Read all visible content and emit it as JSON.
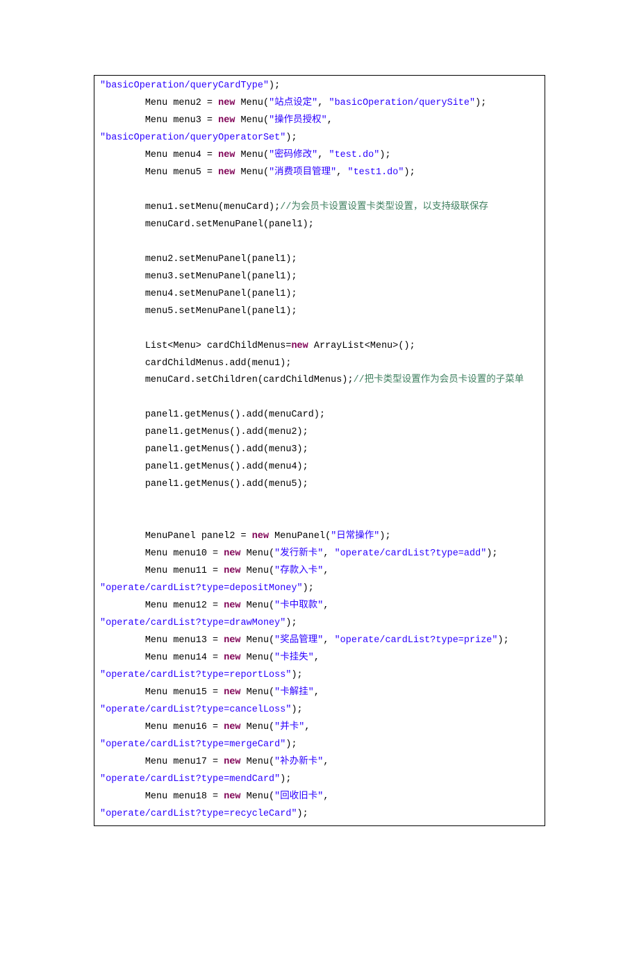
{
  "code_lines": [
    [
      {
        "c": "s",
        "t": "\"basicOperation/queryCardType\""
      },
      {
        "c": "p",
        "t": ");"
      }
    ],
    [
      {
        "c": "p",
        "t": "        Menu menu2 = "
      },
      {
        "c": "k",
        "t": "new"
      },
      {
        "c": "p",
        "t": " Menu("
      },
      {
        "c": "s",
        "t": "\"站点设定\""
      },
      {
        "c": "p",
        "t": ", "
      },
      {
        "c": "s",
        "t": "\"basicOperation/querySite\""
      },
      {
        "c": "p",
        "t": ");"
      }
    ],
    [
      {
        "c": "p",
        "t": "        Menu menu3 = "
      },
      {
        "c": "k",
        "t": "new"
      },
      {
        "c": "p",
        "t": " Menu("
      },
      {
        "c": "s",
        "t": "\"操作员授权\""
      },
      {
        "c": "p",
        "t": ", "
      }
    ],
    [
      {
        "c": "s",
        "t": "\"basicOperation/queryOperatorSet\""
      },
      {
        "c": "p",
        "t": ");"
      }
    ],
    [
      {
        "c": "p",
        "t": "        Menu menu4 = "
      },
      {
        "c": "k",
        "t": "new"
      },
      {
        "c": "p",
        "t": " Menu("
      },
      {
        "c": "s",
        "t": "\"密码修改\""
      },
      {
        "c": "p",
        "t": ", "
      },
      {
        "c": "s",
        "t": "\"test.do\""
      },
      {
        "c": "p",
        "t": ");"
      }
    ],
    [
      {
        "c": "p",
        "t": "        Menu menu5 = "
      },
      {
        "c": "k",
        "t": "new"
      },
      {
        "c": "p",
        "t": " Menu("
      },
      {
        "c": "s",
        "t": "\"消费项目管理\""
      },
      {
        "c": "p",
        "t": ", "
      },
      {
        "c": "s",
        "t": "\"test1.do\""
      },
      {
        "c": "p",
        "t": ");"
      }
    ],
    [
      {
        "c": "p",
        "t": "        "
      }
    ],
    [
      {
        "c": "p",
        "t": "        menu1.setMenu(menuCard);"
      },
      {
        "c": "c",
        "t": "//为会员卡设置设置卡类型设置，以支持级联保存"
      }
    ],
    [
      {
        "c": "p",
        "t": "        menuCard.setMenuPanel(panel1);"
      }
    ],
    [
      {
        "c": "p",
        "t": "        "
      }
    ],
    [
      {
        "c": "p",
        "t": "        menu2.setMenuPanel(panel1);"
      }
    ],
    [
      {
        "c": "p",
        "t": "        menu3.setMenuPanel(panel1);"
      }
    ],
    [
      {
        "c": "p",
        "t": "        menu4.setMenuPanel(panel1);"
      }
    ],
    [
      {
        "c": "p",
        "t": "        menu5.setMenuPanel(panel1);"
      }
    ],
    [
      {
        "c": "p",
        "t": "        "
      }
    ],
    [
      {
        "c": "p",
        "t": "        List<Menu> cardChildMenus="
      },
      {
        "c": "k",
        "t": "new"
      },
      {
        "c": "p",
        "t": " ArrayList<Menu>();"
      }
    ],
    [
      {
        "c": "p",
        "t": "        cardChildMenus.add(menu1);"
      }
    ],
    [
      {
        "c": "p",
        "t": "        menuCard.setChildren(cardChildMenus);"
      },
      {
        "c": "c",
        "t": "//把卡类型设置作为会员卡设置的子菜单"
      }
    ],
    [
      {
        "c": "p",
        "t": "        "
      }
    ],
    [
      {
        "c": "p",
        "t": "        panel1.getMenus().add(menuCard);"
      }
    ],
    [
      {
        "c": "p",
        "t": "        panel1.getMenus().add(menu2);"
      }
    ],
    [
      {
        "c": "p",
        "t": "        panel1.getMenus().add(menu3);"
      }
    ],
    [
      {
        "c": "p",
        "t": "        panel1.getMenus().add(menu4);"
      }
    ],
    [
      {
        "c": "p",
        "t": "        panel1.getMenus().add(menu5);"
      }
    ],
    [
      {
        "c": "p",
        "t": "        "
      }
    ],
    [
      {
        "c": "p",
        "t": "        "
      }
    ],
    [
      {
        "c": "p",
        "t": "        MenuPanel panel2 = "
      },
      {
        "c": "k",
        "t": "new"
      },
      {
        "c": "p",
        "t": " MenuPanel("
      },
      {
        "c": "s",
        "t": "\"日常操作\""
      },
      {
        "c": "p",
        "t": ");"
      }
    ],
    [
      {
        "c": "p",
        "t": "        Menu menu10 = "
      },
      {
        "c": "k",
        "t": "new"
      },
      {
        "c": "p",
        "t": " Menu("
      },
      {
        "c": "s",
        "t": "\"发行新卡\""
      },
      {
        "c": "p",
        "t": ", "
      },
      {
        "c": "s",
        "t": "\"operate/cardList?type=add\""
      },
      {
        "c": "p",
        "t": ");"
      }
    ],
    [
      {
        "c": "p",
        "t": "        Menu menu11 = "
      },
      {
        "c": "k",
        "t": "new"
      },
      {
        "c": "p",
        "t": " Menu("
      },
      {
        "c": "s",
        "t": "\"存款入卡\""
      },
      {
        "c": "p",
        "t": ", "
      }
    ],
    [
      {
        "c": "s",
        "t": "\"operate/cardList?type=depositMoney\""
      },
      {
        "c": "p",
        "t": ");"
      }
    ],
    [
      {
        "c": "p",
        "t": "        Menu menu12 = "
      },
      {
        "c": "k",
        "t": "new"
      },
      {
        "c": "p",
        "t": " Menu("
      },
      {
        "c": "s",
        "t": "\"卡中取款\""
      },
      {
        "c": "p",
        "t": ", "
      }
    ],
    [
      {
        "c": "s",
        "t": "\"operate/cardList?type=drawMoney\""
      },
      {
        "c": "p",
        "t": ");"
      }
    ],
    [
      {
        "c": "p",
        "t": "        Menu menu13 = "
      },
      {
        "c": "k",
        "t": "new"
      },
      {
        "c": "p",
        "t": " Menu("
      },
      {
        "c": "s",
        "t": "\"奖品管理\""
      },
      {
        "c": "p",
        "t": ", "
      },
      {
        "c": "s",
        "t": "\"operate/cardList?type=prize\""
      },
      {
        "c": "p",
        "t": ");"
      }
    ],
    [
      {
        "c": "p",
        "t": "        Menu menu14 = "
      },
      {
        "c": "k",
        "t": "new"
      },
      {
        "c": "p",
        "t": " Menu("
      },
      {
        "c": "s",
        "t": "\"卡挂失\""
      },
      {
        "c": "p",
        "t": ", "
      }
    ],
    [
      {
        "c": "s",
        "t": "\"operate/cardList?type=reportLoss\""
      },
      {
        "c": "p",
        "t": ");"
      }
    ],
    [
      {
        "c": "p",
        "t": "        Menu menu15 = "
      },
      {
        "c": "k",
        "t": "new"
      },
      {
        "c": "p",
        "t": " Menu("
      },
      {
        "c": "s",
        "t": "\"卡解挂\""
      },
      {
        "c": "p",
        "t": ", "
      }
    ],
    [
      {
        "c": "s",
        "t": "\"operate/cardList?type=cancelLoss\""
      },
      {
        "c": "p",
        "t": ");"
      }
    ],
    [
      {
        "c": "p",
        "t": "        Menu menu16 = "
      },
      {
        "c": "k",
        "t": "new"
      },
      {
        "c": "p",
        "t": " Menu("
      },
      {
        "c": "s",
        "t": "\"并卡\""
      },
      {
        "c": "p",
        "t": ", "
      }
    ],
    [
      {
        "c": "s",
        "t": "\"operate/cardList?type=mergeCard\""
      },
      {
        "c": "p",
        "t": ");"
      }
    ],
    [
      {
        "c": "p",
        "t": "        Menu menu17 = "
      },
      {
        "c": "k",
        "t": "new"
      },
      {
        "c": "p",
        "t": " Menu("
      },
      {
        "c": "s",
        "t": "\"补办新卡\""
      },
      {
        "c": "p",
        "t": ", "
      }
    ],
    [
      {
        "c": "s",
        "t": "\"operate/cardList?type=mendCard\""
      },
      {
        "c": "p",
        "t": ");"
      }
    ],
    [
      {
        "c": "p",
        "t": "        Menu menu18 = "
      },
      {
        "c": "k",
        "t": "new"
      },
      {
        "c": "p",
        "t": " Menu("
      },
      {
        "c": "s",
        "t": "\"回收旧卡\""
      },
      {
        "c": "p",
        "t": ", "
      }
    ],
    [
      {
        "c": "s",
        "t": "\"operate/cardList?type=recycleCard\""
      },
      {
        "c": "p",
        "t": ");"
      }
    ]
  ]
}
